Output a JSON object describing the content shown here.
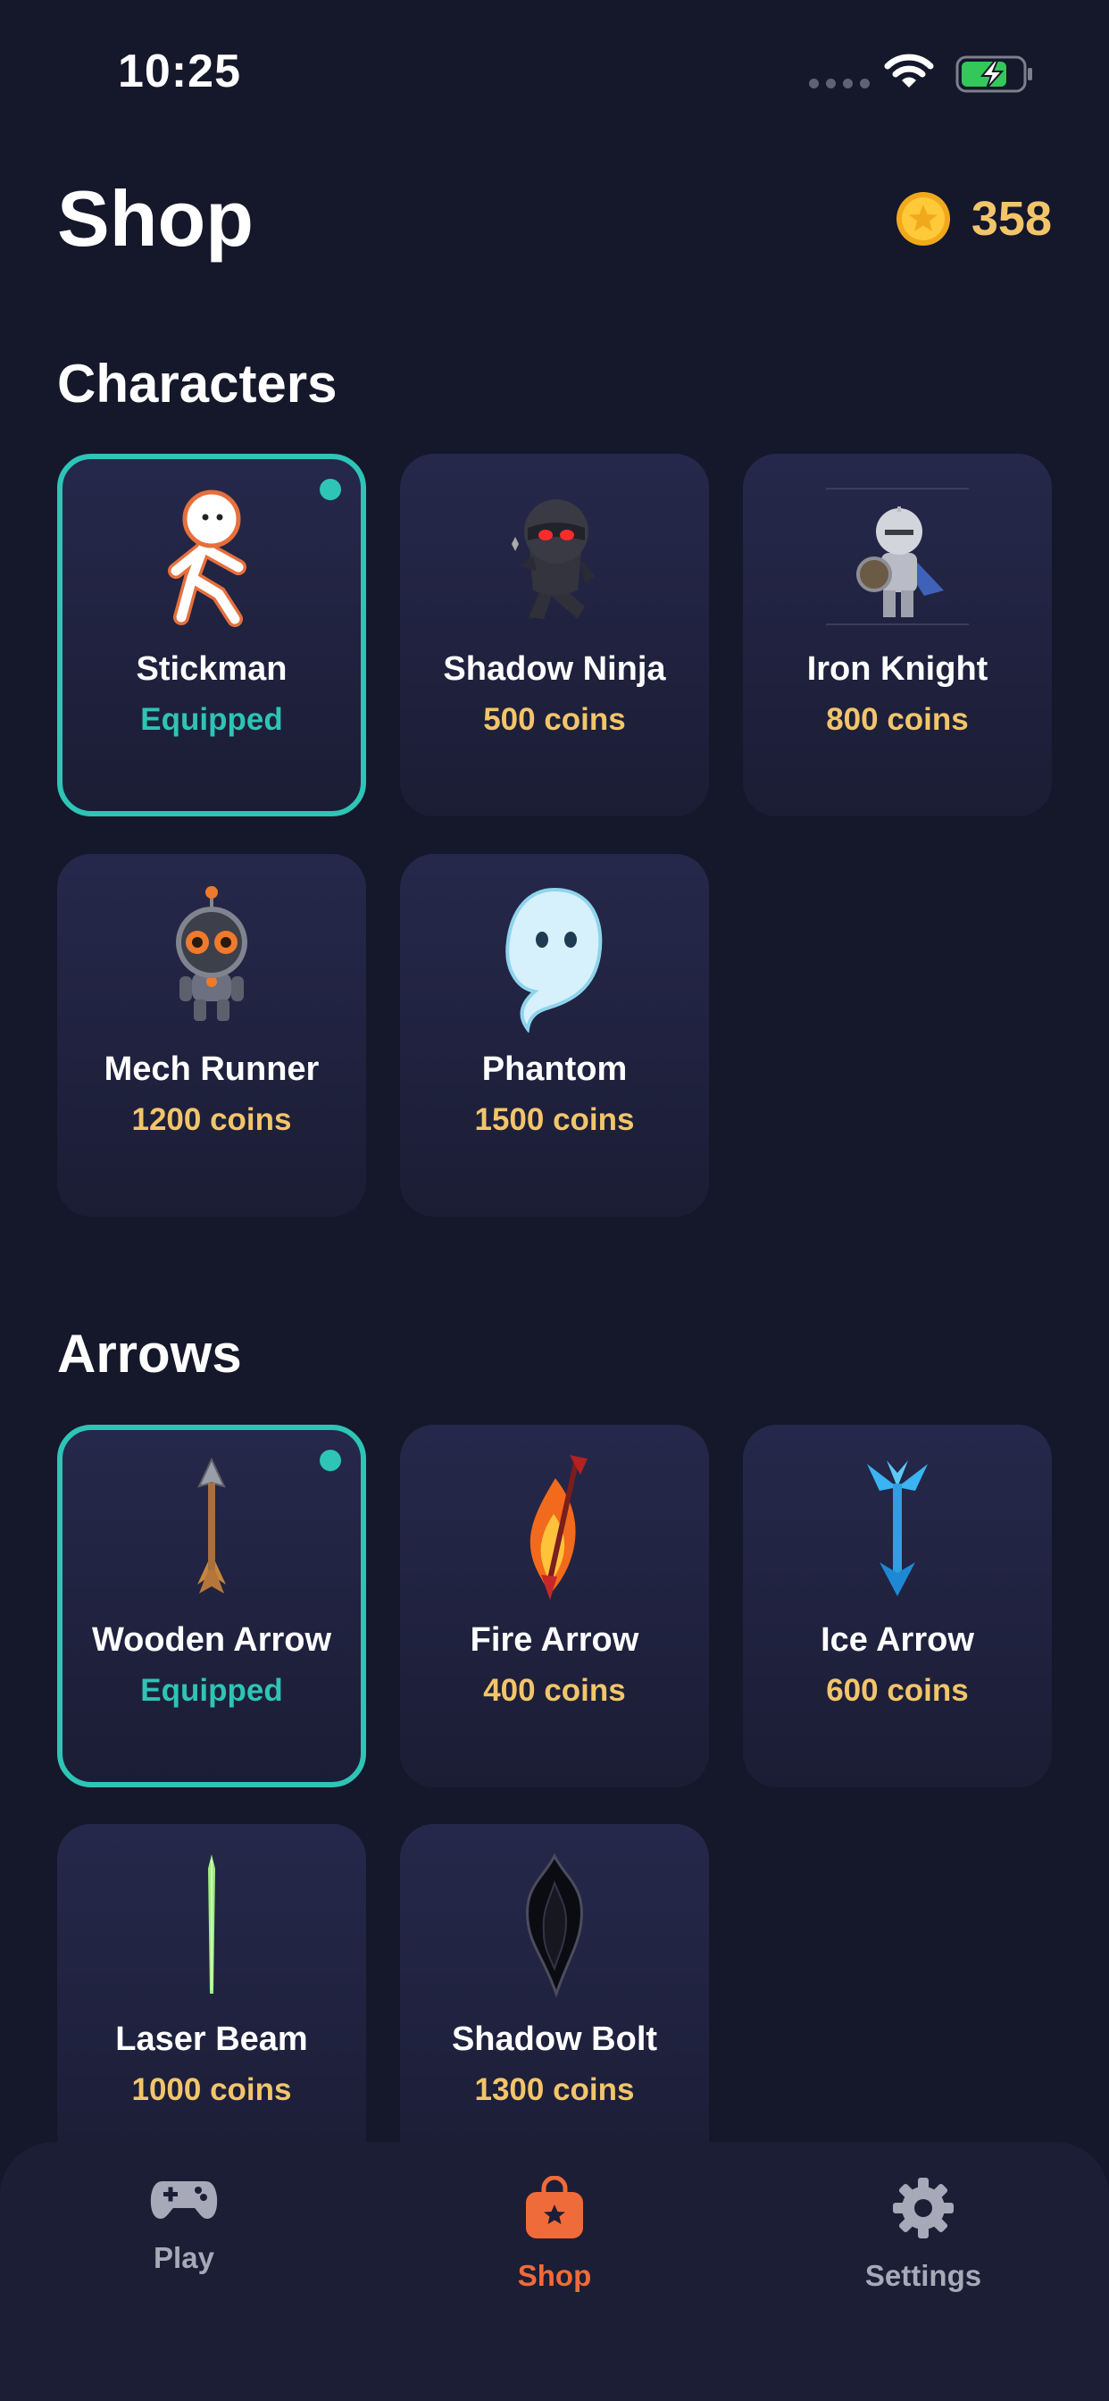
{
  "status": {
    "time": "10:25"
  },
  "header": {
    "title": "Shop",
    "coins": "358"
  },
  "sections": {
    "characters": {
      "title": "Characters",
      "items": [
        {
          "name": "Stickman",
          "price": "Equipped"
        },
        {
          "name": "Shadow Ninja",
          "price": "500 coins"
        },
        {
          "name": "Iron Knight",
          "price": "800 coins"
        },
        {
          "name": "Mech Runner",
          "price": "1200 coins"
        },
        {
          "name": "Phantom",
          "price": "1500 coins"
        }
      ]
    },
    "arrows": {
      "title": "Arrows",
      "items": [
        {
          "name": "Wooden Arrow",
          "price": "Equipped"
        },
        {
          "name": "Fire Arrow",
          "price": "400 coins"
        },
        {
          "name": "Ice Arrow",
          "price": "600 coins"
        },
        {
          "name": "Laser Beam",
          "price": "1000 coins"
        },
        {
          "name": "Shadow Bolt",
          "price": "1300 coins"
        }
      ]
    }
  },
  "tabs": [
    {
      "label": "Play",
      "icon": "gamepad-icon"
    },
    {
      "label": "Shop",
      "icon": "shopping-bag-icon",
      "active": true
    },
    {
      "label": "Settings",
      "icon": "gear-icon"
    }
  ],
  "colors": {
    "accent": "#2ec4b6",
    "coin": "#f3c56a",
    "active_tab": "#f06b3a",
    "background": "#15172a"
  }
}
